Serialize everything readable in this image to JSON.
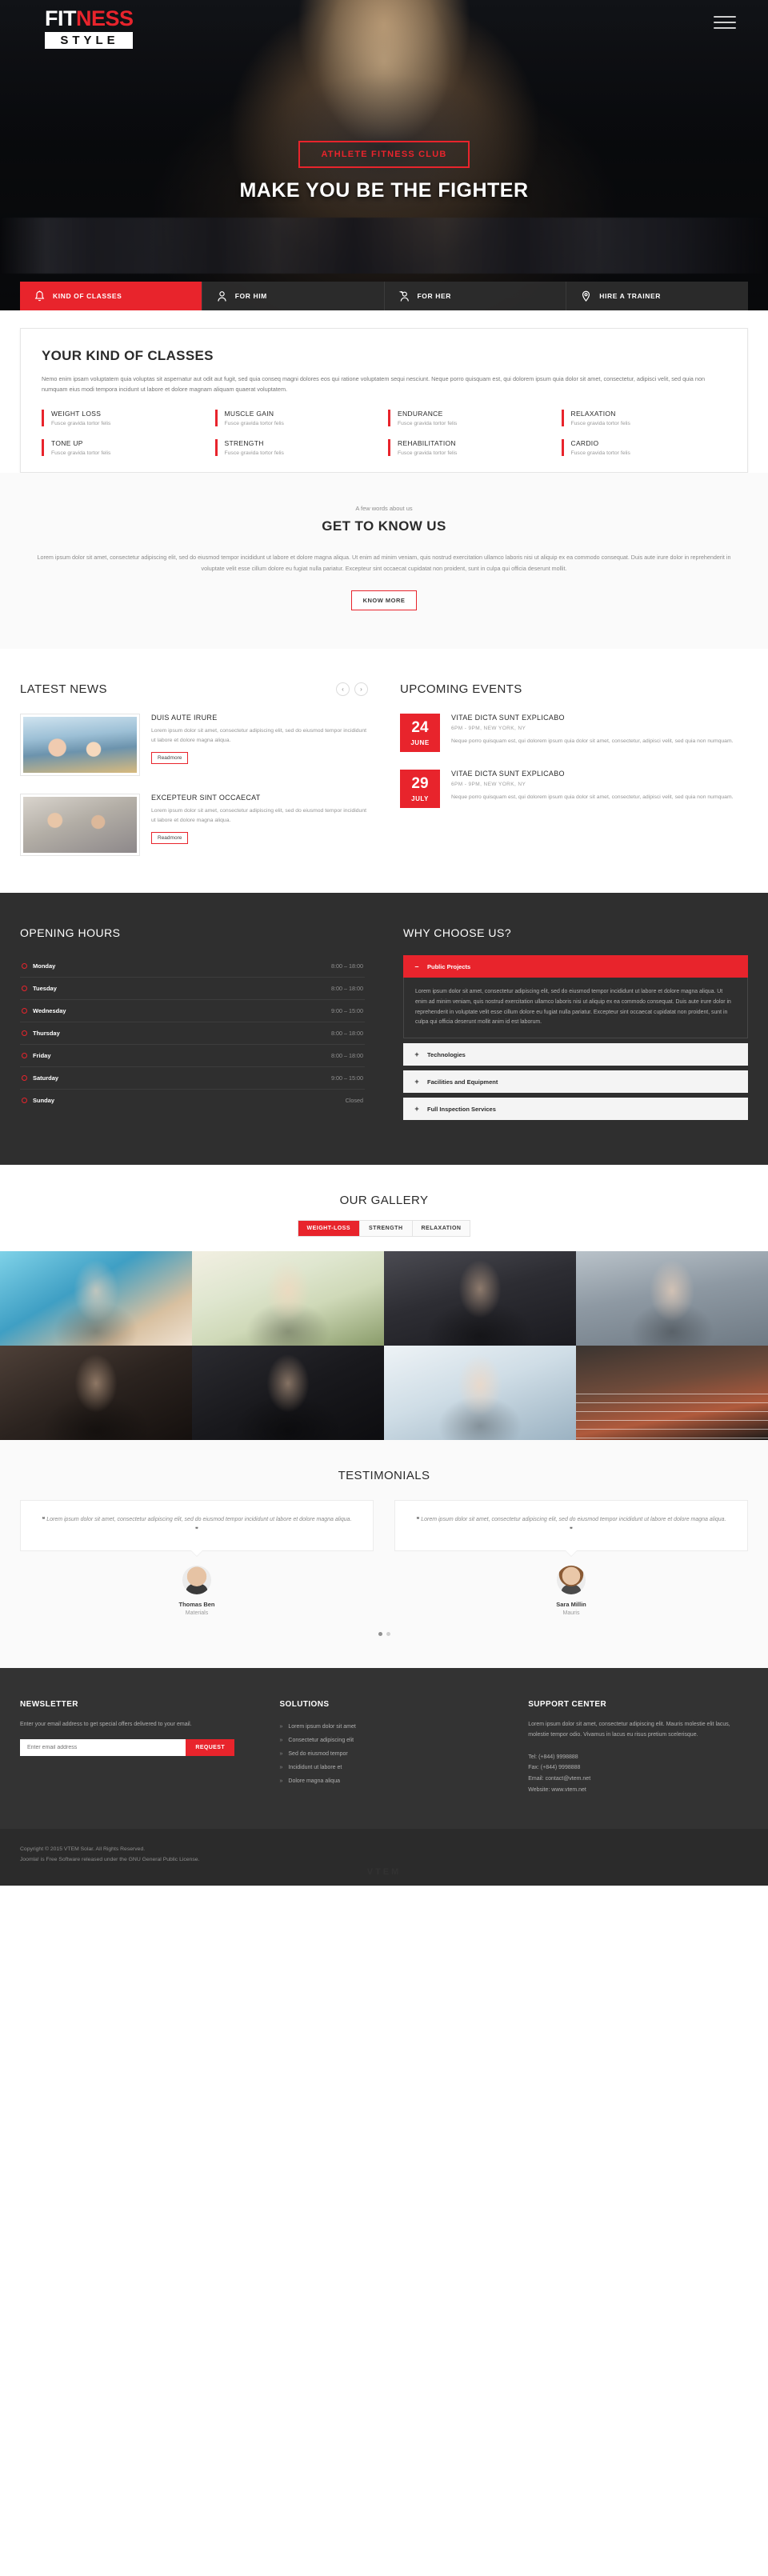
{
  "brand": {
    "logo_top_1": "FIT",
    "logo_top_2": "NESS",
    "logo_bottom": "STYLE"
  },
  "hero": {
    "tagline": "ATHLETE FITNESS CLUB",
    "title": "MAKE YOU BE THE FIGHTER",
    "nav": [
      {
        "label": "KIND OF CLASSES",
        "icon": "bell-icon",
        "active": true
      },
      {
        "label": "FOR HIM",
        "icon": "man-icon",
        "active": false
      },
      {
        "label": "FOR HER",
        "icon": "woman-icon",
        "active": false
      },
      {
        "label": "HIRE A TRAINER",
        "icon": "map-pin-icon",
        "active": false
      }
    ]
  },
  "classes": {
    "title": "YOUR KIND OF CLASSES",
    "lead": "Nemo enim ipsam voluptatem quia voluptas sit aspernatur aut odit aut fugit, sed quia conseq magni dolores eos qui ratione voluptatem sequi nesciunt. Neque porro quisquam est, qui dolorem ipsum quia dolor sit amet, consectetur, adipisci velit, sed quia non numquam eius modi tempora incidunt ut labore et dolore magnam aliquam quaerat voluptatem.",
    "items": [
      {
        "name": "WEIGHT LOSS",
        "desc": "Fusce gravida tortor felis"
      },
      {
        "name": "MUSCLE GAIN",
        "desc": "Fusce gravida tortor felis"
      },
      {
        "name": "ENDURANCE",
        "desc": "Fusce gravida tortor felis"
      },
      {
        "name": "RELAXATION",
        "desc": "Fusce gravida tortor felis"
      },
      {
        "name": "TONE UP",
        "desc": "Fusce gravida tortor felis"
      },
      {
        "name": "STRENGTH",
        "desc": "Fusce gravida tortor felis"
      },
      {
        "name": "REHABILITATION",
        "desc": "Fusce gravida tortor felis"
      },
      {
        "name": "CARDIO",
        "desc": "Fusce gravida tortor felis"
      }
    ]
  },
  "about": {
    "kicker": "A few words about us",
    "title": "GET TO KNOW US",
    "text": "Lorem ipsum dolor sit amet, consectetur adipiscing elit, sed do eiusmod tempor incididunt ut labore et dolore magna aliqua. Ut enim ad minim veniam, quis nostrud exercitation ullamco laboris nisi ut aliquip ex ea commodo consequat. Duis aute irure dolor in reprehenderit in voluptate velit esse cillum dolore eu fugiat nulla pariatur. Excepteur sint occaecat cupidatat non proident, sunt in culpa qui officia deserunt mollit.",
    "button": "KNOW MORE"
  },
  "news": {
    "title": "LATEST NEWS",
    "prev": "‹",
    "next": "›",
    "items": [
      {
        "title": "DUIS AUTE IRURE",
        "text": "Lorem ipsum dolor sit amet, consectetur adipiscing elit, sed do eiusmod tempor incididunt ut labore et dolore magna aliqua.",
        "button": "Readmore",
        "thumb": "gym-couple-photo"
      },
      {
        "title": "EXCEPTEUR SINT OCCAECAT",
        "text": "Lorem ipsum dolor sit amet, consectetur adipiscing elit, sed do eiusmod tempor incididunt ut labore et dolore magna aliqua.",
        "button": "Readmore",
        "thumb": "dumbbell-training-photo"
      }
    ]
  },
  "events": {
    "title": "UPCOMING EVENTS",
    "items": [
      {
        "day": "24",
        "month": "JUNE",
        "title": "VITAE DICTA SUNT EXPLICABO",
        "meta": "6PM - 9PM, NEW YORK, NY",
        "text": "Neque porro quisquam est, qui dolorem ipsum quia dolor sit amet, consectetur, adipisci velit, sed quia non numquam."
      },
      {
        "day": "29",
        "month": "JULY",
        "title": "VITAE DICTA SUNT EXPLICABO",
        "meta": "6PM - 9PM, NEW YORK, NY",
        "text": "Neque porro quisquam est, qui dolorem ipsum quia dolor sit amet, consectetur, adipisci velit, sed quia non numquam."
      }
    ]
  },
  "hours": {
    "title": "OPENING HOURS",
    "rows": [
      {
        "day": "Monday",
        "time": "8:00 – 18:00"
      },
      {
        "day": "Tuesday",
        "time": "8:00 – 18:00"
      },
      {
        "day": "Wednesday",
        "time": "9:00 – 15:00"
      },
      {
        "day": "Thursday",
        "time": "8:00 – 18:00"
      },
      {
        "day": "Friday",
        "time": "8:00 – 18:00"
      },
      {
        "day": "Saturday",
        "time": "9:00 – 15:00"
      },
      {
        "day": "Sunday",
        "time": "Closed"
      }
    ]
  },
  "why": {
    "title": "WHY CHOOSE US?",
    "items": [
      {
        "label": "Public Projects",
        "sign": "–",
        "open": true,
        "body": "Lorem ipsum dolor sit amet, consectetur adipiscing elit, sed do eiusmod tempor incididunt ut labore et dolore magna aliqua. Ut enim ad minim veniam, quis nostrud exercitation ullamco laboris nisi ut aliquip ex ea commodo consequat. Duis aute irure dolor in reprehenderit in voluptate velit esse cillum dolore eu fugiat nulla pariatur. Excepteur sint occaecat cupidatat non proident, sunt in culpa qui officia deserunt mollit anim id est laborum."
      },
      {
        "label": "Technologies",
        "sign": "+",
        "open": false,
        "body": ""
      },
      {
        "label": "Facilities and Equipment",
        "sign": "+",
        "open": false,
        "body": ""
      },
      {
        "label": "Full Inspection Services",
        "sign": "+",
        "open": false,
        "body": ""
      }
    ]
  },
  "gallery": {
    "title": "OUR GALLERY",
    "filters": [
      {
        "label": "WEIGHT-LOSS",
        "active": true
      },
      {
        "label": "STRENGTH",
        "active": false
      },
      {
        "label": "RELAXATION",
        "active": false
      }
    ],
    "tiles": [
      "swimmer-blue-photo",
      "woman-water-bottle-photo",
      "woman-barbell-photo",
      "breakdancer-photo",
      "woman-portrait-photo",
      "man-torso-photo",
      "ballet-dancer-photo",
      "running-track-photo"
    ]
  },
  "testimonials": {
    "title": "TESTIMONIALS",
    "open_quote": "❝",
    "close_quote": "❞",
    "items": [
      {
        "quote": "Lorem ipsum dolor sit amet, consectetur adipiscing elit, sed do eiusmod tempor incididunt ut labore et dolore magna aliqua.",
        "name": "Thomas Ben",
        "role": "Materials"
      },
      {
        "quote": "Lorem ipsum dolor sit amet, consectetur adipiscing elit, sed do eiusmod tempor incididunt ut labore et dolore magna aliqua.",
        "name": "Sara Millin",
        "role": "Mauris"
      }
    ]
  },
  "footer": {
    "newsletter": {
      "title": "NEWSLETTER",
      "text": "Enter your email address to get special offers delivered to your email.",
      "placeholder": "Enter email address",
      "button": "REQUEST"
    },
    "solutions": {
      "title": "SOLUTIONS",
      "items": [
        "Lorem ipsum dolor sit amet",
        "Consectetur adipiscing elit",
        "Sed do eiusmod tempor",
        "Incididunt ut labore et",
        "Dolore magna aliqua"
      ]
    },
    "support": {
      "title": "SUPPORT CENTER",
      "text": "Lorem ipsum dolor sit amet, consectetur adipiscing elit. Mauris molestie elit lacus, molestie tempor odio. Vivamus in lacus eu risus pretium scelerisque.",
      "tel": "Tel: (+844) 9998888",
      "fax": "Fax: (+844) 9998888",
      "email": "Email: contact@vtem.net",
      "website": "Website: www.vtem.net"
    },
    "copyright_line1": "Copyright © 2015 VTEM Solar. All Rights Reserved.",
    "copyright_line2": "Joomla! is Free Software released under the GNU General Public License.",
    "watermark": "VTEM"
  },
  "colors": {
    "accent": "#e8242c",
    "dark": "#2f2f2f",
    "footer": "#333333"
  }
}
